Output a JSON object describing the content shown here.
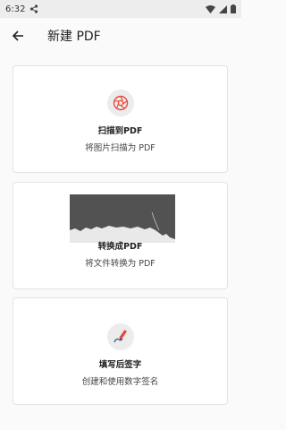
{
  "status": {
    "time": "6:32"
  },
  "appbar": {
    "title": "新建 PDF"
  },
  "cards": [
    {
      "title": "扫描到PDF",
      "subtitle": "将图片扫描为 PDF",
      "icon": "shutter-icon"
    },
    {
      "title": "转换成PDF",
      "subtitle": "将文件转换为 PDF",
      "icon": "document-thumbnail"
    },
    {
      "title": "填写后签字",
      "subtitle": "创建和使用数字签名",
      "icon": "pen-sign-icon"
    }
  ],
  "colors": {
    "accent": "#e8493a",
    "card_border": "#e3e3e3",
    "background": "#fafafa"
  }
}
